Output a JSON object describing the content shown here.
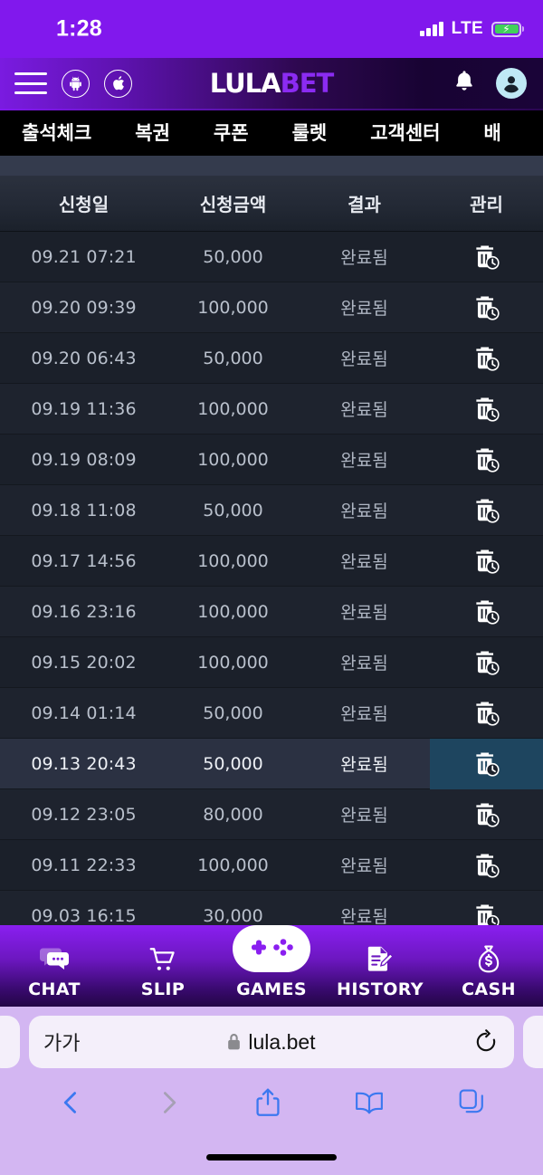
{
  "status_bar": {
    "time": "1:28",
    "network": "LTE",
    "signal_icon": "signal-bars-icon",
    "battery_icon": "battery-charging-icon",
    "battery_charging": true,
    "background_color": "#8118ED"
  },
  "app_header": {
    "menu_icon": "hamburger-menu-icon",
    "android_icon": "android-icon",
    "apple_icon": "apple-icon",
    "logo_part1": "LULA",
    "logo_part2": "BET",
    "logo_color_1": "#ffffff",
    "logo_color_2": "#8B2BF2",
    "bell_icon": "bell-icon",
    "account_icon": "user-avatar-icon"
  },
  "nav_tabs": [
    {
      "label": "출석체크"
    },
    {
      "label": "복권"
    },
    {
      "label": "쿠폰"
    },
    {
      "label": "룰렛"
    },
    {
      "label": "고객센터"
    },
    {
      "label": "배"
    }
  ],
  "table": {
    "columns": [
      "신청일",
      "신청금액",
      "결과",
      "관리"
    ],
    "action_icon": "trash-clock-icon",
    "selected_row_index": 10,
    "selected_highlight_color": "#1E455F",
    "rows": [
      {
        "date": "09.21 07:21",
        "amount": "50,000",
        "result": "완료됨"
      },
      {
        "date": "09.20 09:39",
        "amount": "100,000",
        "result": "완료됨"
      },
      {
        "date": "09.20 06:43",
        "amount": "50,000",
        "result": "완료됨"
      },
      {
        "date": "09.19 11:36",
        "amount": "100,000",
        "result": "완료됨"
      },
      {
        "date": "09.19 08:09",
        "amount": "100,000",
        "result": "완료됨"
      },
      {
        "date": "09.18 11:08",
        "amount": "50,000",
        "result": "완료됨"
      },
      {
        "date": "09.17 14:56",
        "amount": "100,000",
        "result": "완료됨"
      },
      {
        "date": "09.16 23:16",
        "amount": "100,000",
        "result": "완료됨"
      },
      {
        "date": "09.15 20:02",
        "amount": "100,000",
        "result": "완료됨"
      },
      {
        "date": "09.14 01:14",
        "amount": "50,000",
        "result": "완료됨"
      },
      {
        "date": "09.13 20:43",
        "amount": "50,000",
        "result": "완료됨"
      },
      {
        "date": "09.12 23:05",
        "amount": "80,000",
        "result": "완료됨"
      },
      {
        "date": "09.11 22:33",
        "amount": "100,000",
        "result": "완료됨"
      },
      {
        "date": "09.03 16:15",
        "amount": "30,000",
        "result": "완료됨"
      }
    ]
  },
  "bottom_nav": {
    "items": [
      {
        "label": "CHAT",
        "icon": "chat-bubbles-icon"
      },
      {
        "label": "SLIP",
        "icon": "shopping-cart-icon"
      },
      {
        "label": "GAMES",
        "icon": "gamepad-icon"
      },
      {
        "label": "HISTORY",
        "icon": "document-pencil-icon"
      },
      {
        "label": "CASH",
        "icon": "money-bag-icon"
      }
    ],
    "accent_color": "#8A1FF0"
  },
  "browser": {
    "text_size_label": "가가",
    "lock_icon": "lock-icon",
    "url": "lula.bet",
    "reload_icon": "reload-icon",
    "back_icon": "chevron-left-icon",
    "forward_icon": "chevron-right-icon",
    "share_icon": "share-icon",
    "bookmarks_icon": "book-icon",
    "tabs_icon": "tabs-icon",
    "back_enabled": true,
    "forward_enabled": false
  }
}
